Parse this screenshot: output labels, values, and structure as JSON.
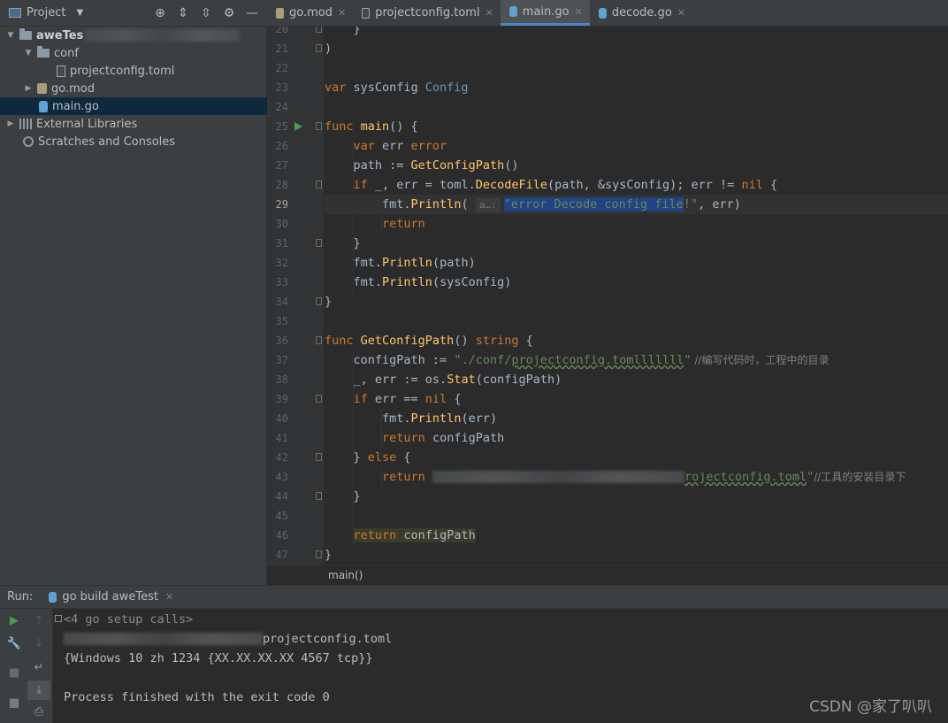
{
  "project_panel": {
    "title": "Project",
    "tree": [
      {
        "label": "aweTes",
        "kind": "folder",
        "expanded": true
      },
      {
        "label": "conf",
        "kind": "folder",
        "expanded": true
      },
      {
        "label": "projectconfig.toml",
        "kind": "file"
      },
      {
        "label": "go.mod",
        "kind": "gomod",
        "expanded": false
      },
      {
        "label": "main.go",
        "kind": "gofile",
        "selected": true
      },
      {
        "label": "External Libraries",
        "kind": "libs",
        "expanded": false
      },
      {
        "label": "Scratches and Consoles",
        "kind": "scratch"
      }
    ]
  },
  "editor_tabs": [
    {
      "label": "go.mod",
      "active": false
    },
    {
      "label": "projectconfig.toml",
      "active": false
    },
    {
      "label": "main.go",
      "active": true
    },
    {
      "label": "decode.go",
      "active": false
    }
  ],
  "editor": {
    "line_numbers": [
      "20",
      "21",
      "22",
      "23",
      "24",
      "25",
      "26",
      "27",
      "28",
      "29",
      "30",
      "31",
      "32",
      "33",
      "34",
      "35",
      "36",
      "37",
      "38",
      "39",
      "40",
      "41",
      "42",
      "43",
      "44",
      "45",
      "46",
      "47"
    ],
    "current_line": "29",
    "hint_label": "a…:",
    "lines": {
      "l20": "}",
      "l21": ")",
      "l23_kw": "var",
      "l23_name": " sysConfig ",
      "l23_type": "Config",
      "l25_kw": "func",
      "l25_fn": " main",
      "l25_rest": "() {",
      "l26_kw": "var",
      "l26_name": " err ",
      "l26_type": "error",
      "l27_a": "path := ",
      "l27_fn": "GetConfigPath",
      "l27_b": "()",
      "l28_kw": "if",
      "l28_a": " _, err = toml.",
      "l28_fn": "DecodeFile",
      "l28_b": "(path, &sysConfig); err != ",
      "l28_nil": "nil",
      "l28_c": " {",
      "l29_a": "fmt.",
      "l29_fn": "Println",
      "l29_b": "( ",
      "l29_sel": "\"error Decode config file",
      "l29_str": "!\"",
      "l29_c": ", err)",
      "l30_kw": "return",
      "l31": "}",
      "l32_a": "fmt.",
      "l32_fn": "Println",
      "l32_b": "(path)",
      "l33_a": "fmt.",
      "l33_fn": "Println",
      "l33_b": "(sysConfig)",
      "l34": "}",
      "l36_kw": "func",
      "l36_fn": " GetConfigPath",
      "l36_a": "() ",
      "l36_kw2": "string",
      "l36_b": " {",
      "l37_a": "configPath := ",
      "l37_str1": "\"./conf/",
      "l37_str2": "projectconfig.tomlllllll",
      "l37_str3": "\"",
      "l37_cm": " //编写代码时，工程中的目录",
      "l38_a": "_, err := os.",
      "l38_fn": "Stat",
      "l38_b": "(configPath)",
      "l39_kw": "if",
      "l39_a": " err == ",
      "l39_nil": "nil",
      "l39_b": " {",
      "l40_a": "fmt.",
      "l40_fn": "Println",
      "l40_b": "(err)",
      "l41_kw": "return",
      "l41_a": " configPath",
      "l42_a": "} ",
      "l42_kw": "else",
      "l42_b": " {",
      "l43_kw": "return",
      "l43_str": "rojectconfig.toml",
      "l43_str2": "\"",
      "l43_cm": "//工具的安装目录下",
      "l44": "}",
      "l46_kw": "return",
      "l46_a": " configPath",
      "l47": "}"
    }
  },
  "breadcrumb": "main()",
  "run_panel": {
    "label": "Run:",
    "tab_label": "go build aweTest",
    "console": {
      "setup": "<4 go setup calls>",
      "path_suffix": "projectconfig.toml",
      "output": "{Windows 10 zh 1234 {XX.XX.XX.XX 4567 tcp}}",
      "finished": "Process finished with the exit code 0"
    }
  },
  "watermark": "CSDN @家了叭叭",
  "colors": {
    "keyword": "#cc7832",
    "function": "#ffc66d",
    "type": "#6897bb",
    "string": "#6a8759",
    "comment": "#808080",
    "selection": "#214283",
    "accent": "#4a88c7"
  }
}
